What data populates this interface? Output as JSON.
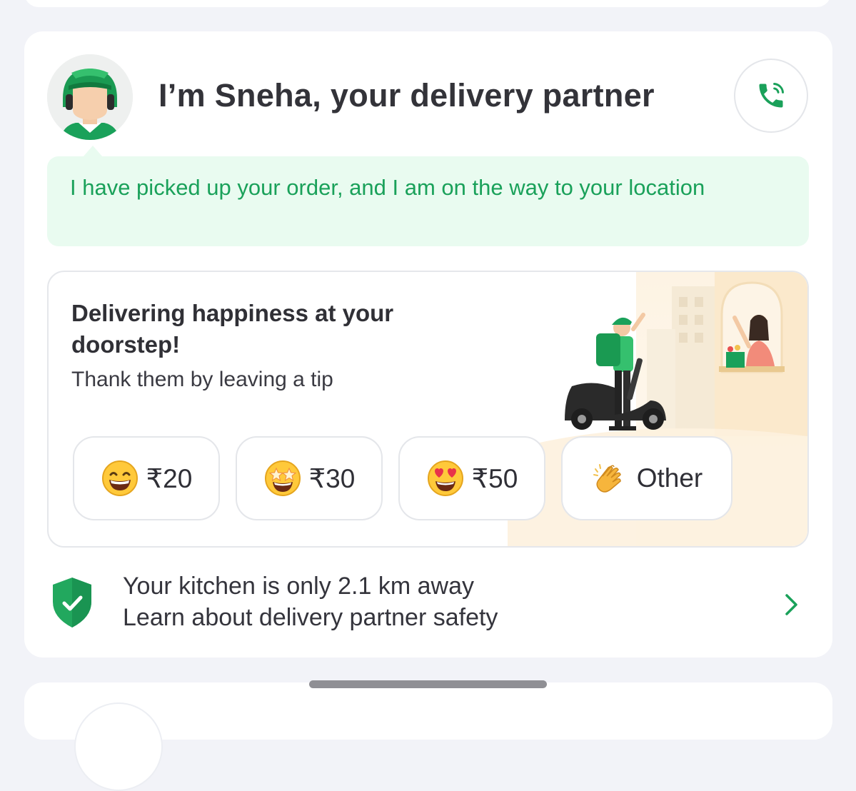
{
  "partner": {
    "title": "I’m Sneha, your delivery partner",
    "status_message": "I have picked up your order, and I am on the way to your location"
  },
  "tip": {
    "heading": "Delivering happiness at your doorstep!",
    "subtitle": "Thank them by leaving a tip",
    "options": [
      {
        "label": "₹20",
        "icon": "grinning-face-icon"
      },
      {
        "label": "₹30",
        "icon": "star-struck-face-icon"
      },
      {
        "label": "₹50",
        "icon": "heart-eyes-face-icon"
      },
      {
        "label": "Other",
        "icon": "clapping-hands-icon"
      }
    ]
  },
  "safety": {
    "line1": "Your kitchen is only 2.1 km away",
    "line2": "Learn about delivery partner safety",
    "icon": "shield-check-icon"
  },
  "colors": {
    "brand_green": "#1aa15a",
    "bubble_bg": "#e9fbf0",
    "page_bg": "#f2f3f8"
  }
}
